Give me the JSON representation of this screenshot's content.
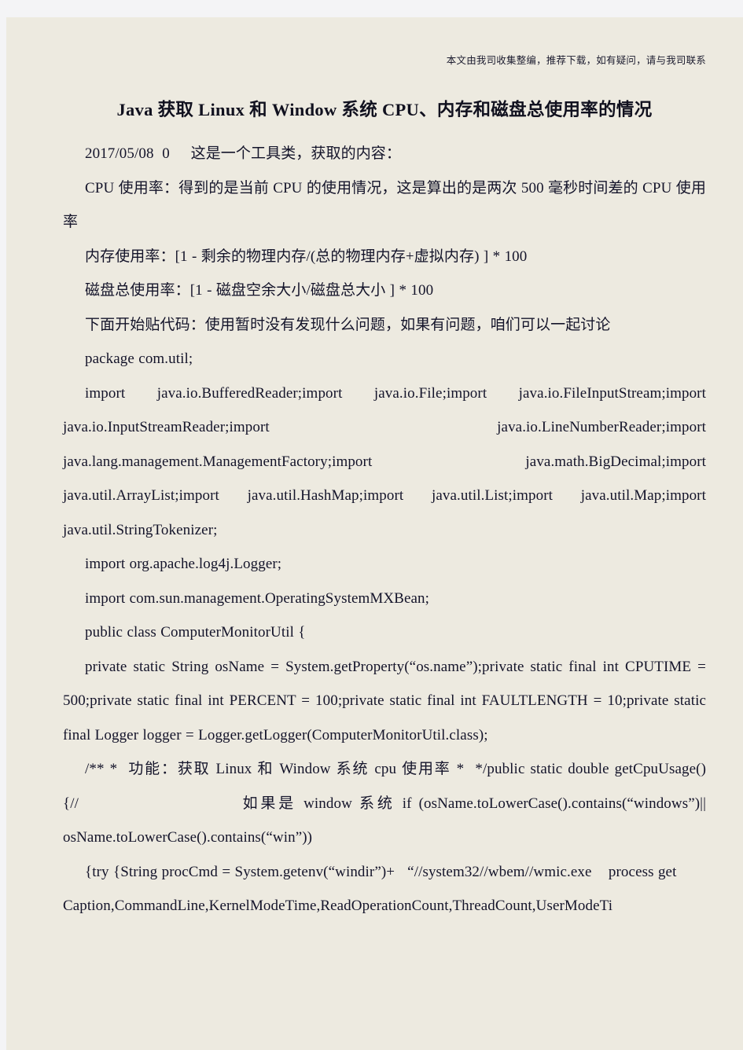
{
  "page": {
    "background_color": "#edeae0",
    "outer_color": "#f4f4f6",
    "text_color": "#14142a"
  },
  "header": {
    "note": "本文由我司收集整编，推荐下载，如有疑问，请与我司联系"
  },
  "title": "Java 获取 Linux 和 Window 系统 CPU、内存和磁盘总使用率的情况",
  "body": {
    "meta_line": "2017/05/08  0     这是一个工具类，获取的内容：",
    "p_cpu": "CPU 使用率：得到的是当前 CPU 的使用情况，这是算出的是两次 500 毫秒时间差的 CPU 使用率",
    "p_mem": "内存使用率：[1 - 剩余的物理内存/(总的物理内存+虚拟内存) ] * 100",
    "p_disk": "磁盘总使用率：[1 - 磁盘空余大小/磁盘总大小 ] * 100",
    "p_intro": "下面开始贴代码：使用暂时没有发现什么问题，如果有问题，咱们可以一起讨论",
    "code_package": "package com.util;",
    "code_imports_1": "import java.io.BufferedReader;import java.io.File;import java.io.FileInputStream;import java.io.InputStreamReader;import java.io.LineNumberReader;import java.lang.management.ManagementFactory;import java.math.BigDecimal;import java.util.ArrayList;import java.util.HashMap;import java.util.List;import java.util.Map;import java.util.StringTokenizer;",
    "code_import_log4j": "import org.apache.log4j.Logger;",
    "code_import_mxbean": "import com.sun.management.OperatingSystemMXBean;",
    "code_class_decl": "public class ComputerMonitorUtil {",
    "code_fields": "private static String osName = System.getProperty(“os.name”);private static final int CPUTIME = 500;private static final int PERCENT = 100;private static final int FAULTLENGTH = 10;private static final Logger logger = Logger.getLogger(ComputerMonitorUtil.class);",
    "code_javadoc": "/** *  功能：获取 Linux 和 Window 系统 cpu 使用率 *  */public static double getCpuUsage()                                  {//                       如果是 window 系统 if (osName.toLowerCase().contains(“windows”)||       osName.toLowerCase().contains(“win”))",
    "code_try": "{try {String procCmd = System.getenv(“windir”)+   “//system32//wbem//wmic.exe    process get",
    "code_tail": "Caption,CommandLine,KernelModeTime,ReadOperationCount,ThreadCount,UserModeTi"
  }
}
